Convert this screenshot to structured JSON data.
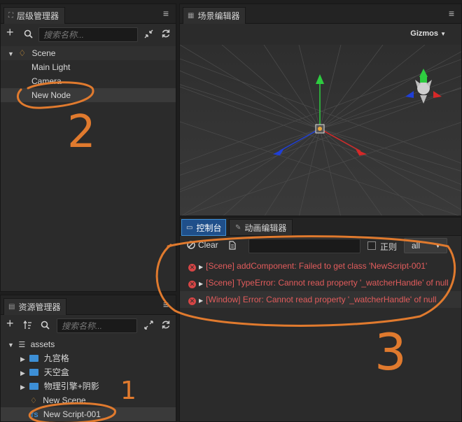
{
  "hierarchy": {
    "title": "层级管理器",
    "search_placeholder": "搜索名称...",
    "nodes": [
      {
        "label": "Scene"
      },
      {
        "label": "Main Light"
      },
      {
        "label": "Camera"
      },
      {
        "label": "New Node"
      }
    ]
  },
  "scene_editor": {
    "title": "场景编辑器",
    "gizmos_label": "Gizmos"
  },
  "console": {
    "tabs": [
      {
        "label": "控制台"
      },
      {
        "label": "动画编辑器"
      }
    ],
    "clear_label": "Clear",
    "regex_label": "正则",
    "filter_value": "all",
    "messages": [
      {
        "text": "[Scene] addComponent: Failed to get class 'NewScript-001'"
      },
      {
        "text": "[Scene] TypeError: Cannot read property '_watcherHandle' of null"
      },
      {
        "text": "[Window] Error: Cannot read property '_watcherHandle' of null"
      }
    ]
  },
  "assets": {
    "title": "资源管理器",
    "search_placeholder": "搜索名称...",
    "items": [
      {
        "label": "assets"
      },
      {
        "label": "九宫格"
      },
      {
        "label": "天空盒"
      },
      {
        "label": "物理引擎+阴影"
      },
      {
        "label": "New Scene"
      },
      {
        "label": "New Script-001"
      }
    ]
  },
  "annotations": {
    "n1": "1",
    "n2": "2",
    "n3": "3"
  },
  "colors": {
    "accent": "#3d8fd6",
    "error": "#e25c5c",
    "annotation": "#e07a2e",
    "axis_x": "#d62828",
    "axis_y": "#2ecc40",
    "axis_z": "#1f3fd6"
  }
}
